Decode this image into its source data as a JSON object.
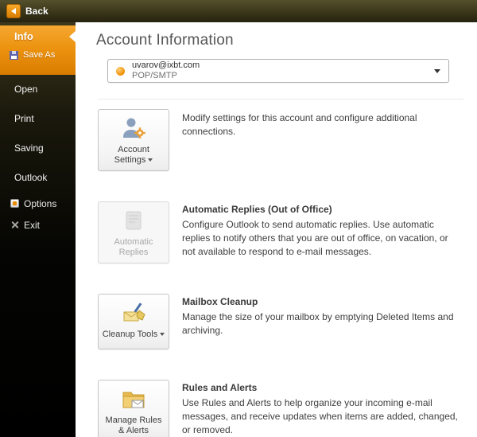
{
  "colors": {
    "accent_orange": "#ec9310",
    "topbar_dark": "#3a3619",
    "content_bg": "#ffffff"
  },
  "topbar": {
    "back": {
      "label": "Back",
      "icon": "back-arrow"
    }
  },
  "sidebar": {
    "active_group": {
      "info": {
        "label": "Info"
      },
      "save_as": {
        "label": "Save As",
        "icon": "floppy-disk"
      }
    },
    "items": [
      {
        "label": "Open"
      },
      {
        "label": "Print"
      },
      {
        "label": "Saving"
      },
      {
        "label": "Outlook"
      },
      {
        "label": "Options",
        "icon": "options-gear"
      },
      {
        "label": "Exit",
        "icon": "exit-cross"
      }
    ]
  },
  "main": {
    "title": "Account Information",
    "account_selector": {
      "email": "uvarov@ixbt.com",
      "protocol": "POP/SMTP",
      "icon": "account-dot"
    },
    "sections": [
      {
        "button_label": "Account Settings",
        "has_menu": true,
        "icon": "account-settings",
        "heading": "",
        "description": "Modify settings for this account and configure additional connections."
      },
      {
        "button_label": "Automatic Replies",
        "disabled": true,
        "icon": "automatic-replies",
        "heading": "Automatic Replies (Out of Office)",
        "description": "Configure Outlook to send automatic replies. Use automatic replies to notify others that you are out of office, on vacation, or not available to respond to e-mail messages."
      },
      {
        "button_label": "Cleanup Tools",
        "has_menu": true,
        "icon": "cleanup-tools",
        "heading": "Mailbox Cleanup",
        "description": "Manage the size of your mailbox by emptying Deleted Items and archiving."
      },
      {
        "button_label": "Manage Rules & Alerts",
        "icon": "rules-alerts",
        "heading": "Rules and Alerts",
        "description": "Use Rules and Alerts to help organize your incoming e-mail messages, and receive updates when items are added, changed, or removed."
      }
    ]
  }
}
